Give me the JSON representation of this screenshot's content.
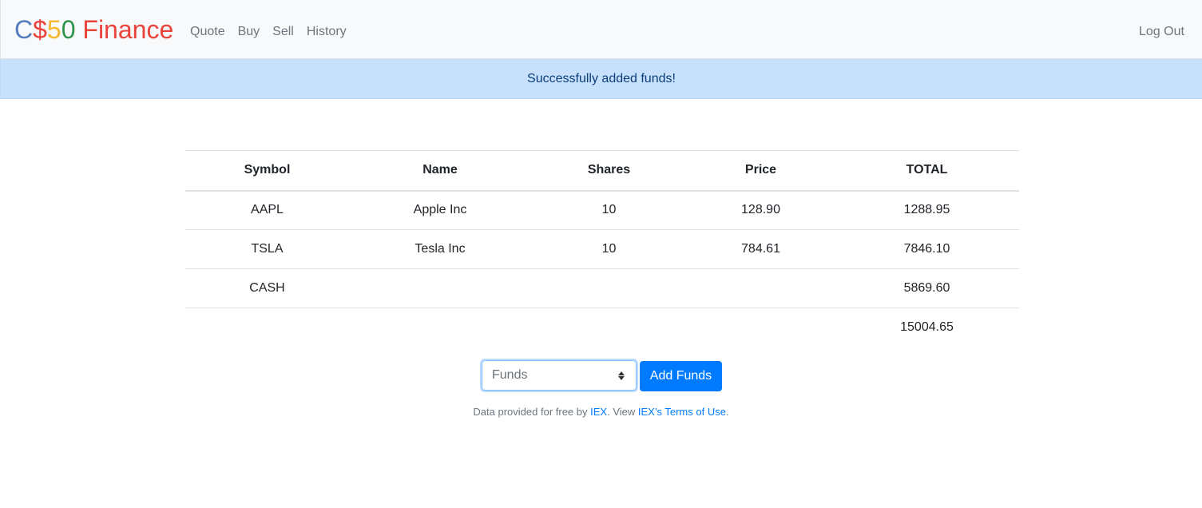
{
  "navbar": {
    "brand": {
      "parts": [
        {
          "text": "C",
          "color": "#537fbe"
        },
        {
          "text": "$",
          "color": "#ea433b"
        },
        {
          "text": "5",
          "color": "#f5b82e"
        },
        {
          "text": "0",
          "color": "#2e944b"
        },
        {
          "text": " Finance",
          "color": "#ea433b"
        }
      ]
    },
    "links": [
      "Quote",
      "Buy",
      "Sell",
      "History"
    ],
    "logout": "Log Out"
  },
  "alert": {
    "message": "Successfully added funds!"
  },
  "table": {
    "headers": [
      "Symbol",
      "Name",
      "Shares",
      "Price",
      "TOTAL"
    ],
    "rows": [
      [
        "AAPL",
        "Apple Inc",
        "10",
        "128.90",
        "1288.95"
      ],
      [
        "TSLA",
        "Tesla Inc",
        "10",
        "784.61",
        "7846.10"
      ],
      [
        "CASH",
        "",
        "",
        "",
        "5869.60"
      ]
    ],
    "footer": [
      "",
      "",
      "",
      "",
      "15004.65"
    ]
  },
  "funds_form": {
    "placeholder": "Funds",
    "button_label": "Add Funds"
  },
  "footer": {
    "prefix": "Data provided for free by ",
    "iex_link": "IEX",
    "middle": ". View ",
    "terms_link": "IEX’s Terms of Use",
    "suffix": "."
  }
}
